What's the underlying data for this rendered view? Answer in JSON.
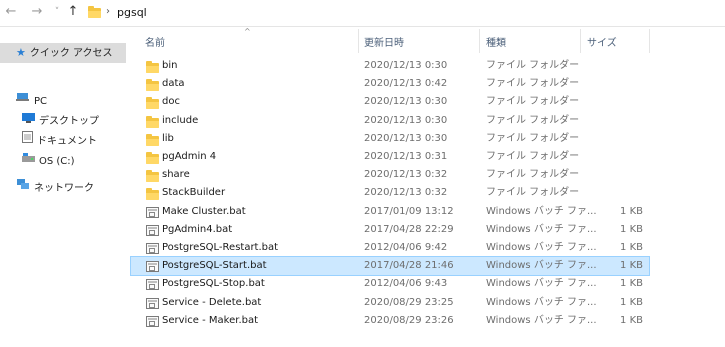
{
  "address": {
    "back_icon": "back-arrow-icon",
    "forward_icon": "forward-arrow-icon",
    "up_icon": "up-arrow-icon",
    "separator": "›",
    "path": "pgsql"
  },
  "sidebar": {
    "items": [
      {
        "label": "クイック アクセス",
        "icon": "star-icon"
      },
      {
        "label": "PC",
        "icon": "pc-icon"
      },
      {
        "label": "デスクトップ",
        "icon": "desktop-icon"
      },
      {
        "label": "ドキュメント",
        "icon": "documents-icon"
      },
      {
        "label": "OS (C:)",
        "icon": "drive-icon"
      },
      {
        "label": "ネットワーク",
        "icon": "network-icon"
      }
    ]
  },
  "columns": {
    "name": "名前",
    "date": "更新日時",
    "type": "種類",
    "size": "サイズ"
  },
  "rows": [
    {
      "name": "bin",
      "date": "2020/12/13 0:30",
      "type": "ファイル フォルダー",
      "size": "",
      "kind": "folder"
    },
    {
      "name": "data",
      "date": "2020/12/13 0:42",
      "type": "ファイル フォルダー",
      "size": "",
      "kind": "folder"
    },
    {
      "name": "doc",
      "date": "2020/12/13 0:30",
      "type": "ファイル フォルダー",
      "size": "",
      "kind": "folder"
    },
    {
      "name": "include",
      "date": "2020/12/13 0:30",
      "type": "ファイル フォルダー",
      "size": "",
      "kind": "folder"
    },
    {
      "name": "lib",
      "date": "2020/12/13 0:30",
      "type": "ファイル フォルダー",
      "size": "",
      "kind": "folder"
    },
    {
      "name": "pgAdmin 4",
      "date": "2020/12/13 0:31",
      "type": "ファイル フォルダー",
      "size": "",
      "kind": "folder"
    },
    {
      "name": "share",
      "date": "2020/12/13 0:32",
      "type": "ファイル フォルダー",
      "size": "",
      "kind": "folder"
    },
    {
      "name": "StackBuilder",
      "date": "2020/12/13 0:32",
      "type": "ファイル フォルダー",
      "size": "",
      "kind": "folder"
    },
    {
      "name": "Make Cluster.bat",
      "date": "2017/01/09 13:12",
      "type": "Windows バッチ ファ...",
      "size": "1 KB",
      "kind": "bat"
    },
    {
      "name": "PgAdmin4.bat",
      "date": "2017/04/28 22:29",
      "type": "Windows バッチ ファ...",
      "size": "1 KB",
      "kind": "bat"
    },
    {
      "name": "PostgreSQL-Restart.bat",
      "date": "2012/04/06 9:42",
      "type": "Windows バッチ ファ...",
      "size": "1 KB",
      "kind": "bat"
    },
    {
      "name": "PostgreSQL-Start.bat",
      "date": "2017/04/28 21:46",
      "type": "Windows バッチ ファ...",
      "size": "1 KB",
      "kind": "bat",
      "selected": true
    },
    {
      "name": "PostgreSQL-Stop.bat",
      "date": "2012/04/06 9:43",
      "type": "Windows バッチ ファ...",
      "size": "1 KB",
      "kind": "bat"
    },
    {
      "name": "Service - Delete.bat",
      "date": "2020/08/29 23:25",
      "type": "Windows バッチ ファ...",
      "size": "1 KB",
      "kind": "bat"
    },
    {
      "name": "Service - Maker.bat",
      "date": "2020/08/29 23:26",
      "type": "Windows バッチ ファ...",
      "size": "1 KB",
      "kind": "bat"
    }
  ],
  "colors": {
    "selection_bg": "#cce8ff",
    "selection_border": "#99d1ff",
    "folder": "#ffd866",
    "header_text": "#4c607a"
  }
}
